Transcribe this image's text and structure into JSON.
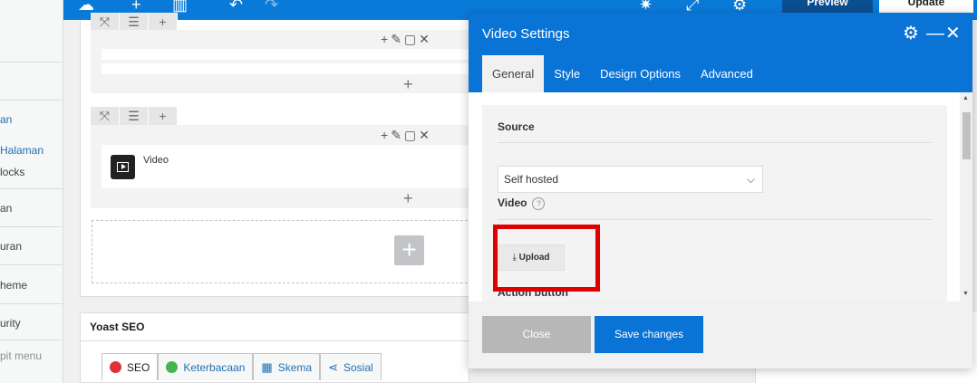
{
  "topbar": {
    "preview_label": "Preview",
    "update_label": "Update"
  },
  "sidebar": {
    "items": [
      {
        "label": "an"
      },
      {
        "label": "Halaman"
      },
      {
        "label": "locks"
      },
      {
        "label": "an"
      },
      {
        "label": "uran"
      },
      {
        "label": "heme"
      },
      {
        "label": "urity"
      },
      {
        "label": "pit menu"
      }
    ]
  },
  "editor": {
    "video_label": "Video"
  },
  "yoast": {
    "title": "Yoast SEO",
    "tabs": [
      {
        "label": "SEO"
      },
      {
        "label": "Keterbacaan"
      },
      {
        "label": "Skema"
      },
      {
        "label": "Sosial"
      }
    ]
  },
  "panel": {
    "title": "Video Settings",
    "tabs": [
      {
        "label": "General"
      },
      {
        "label": "Style"
      },
      {
        "label": "Design Options"
      },
      {
        "label": "Advanced"
      }
    ],
    "source_label": "Source",
    "source_value": "Self hosted",
    "video_label": "Video",
    "help_glyph": "?",
    "upload_label": "Upload",
    "action_label": "Action button",
    "close_label": "Close",
    "save_label": "Save changes"
  },
  "colors": {
    "accent": "#0a73d6",
    "highlight": "#e00000"
  }
}
